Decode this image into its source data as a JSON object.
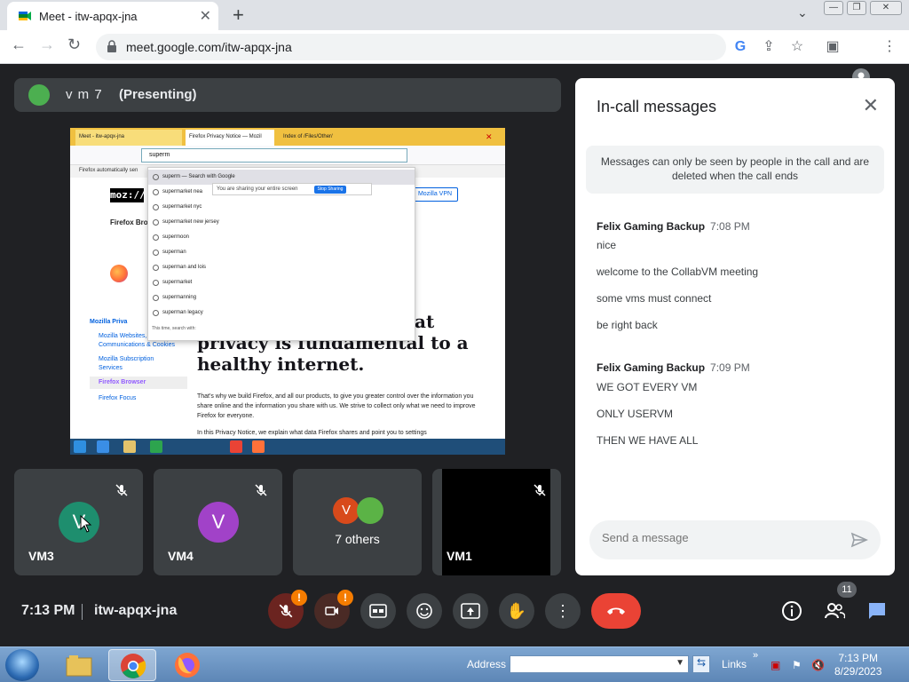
{
  "browser": {
    "tab_title": "Meet - itw-apqx-jna",
    "url": "meet.google.com/itw-apqx-jna"
  },
  "presenter": {
    "name": "v m 7",
    "tag": "(Presenting)"
  },
  "shared_screen": {
    "tabs": [
      "Meet - itw-apqx-jna",
      "Firefox Privacy Notice — Mozil",
      "Index of /Files/Other/"
    ],
    "search_text": "superm",
    "infobar": "Firefox automatically sen",
    "suggestions": [
      "superm — Search with Google",
      "supermarket nea",
      "supermarket nyc",
      "supermarket new jersey",
      "supermoon",
      "superman",
      "superman and lois",
      "supermarket",
      "supermanning",
      "superman legacy"
    ],
    "share_notice": "You are sharing your entire screen",
    "stop_sharing": "Stop Sharing",
    "search_footer": "This time, search with:",
    "logo": "moz://a",
    "vpn": "Mozilla VPN",
    "firefox_bro": "Firefox Bro",
    "nav_title": "Mozilla Priva",
    "nav_items": [
      "Mozilla Websites, Communications & Cookies",
      "Mozilla Subscription Services",
      "Firefox Browser",
      "Firefox Focus"
    ],
    "headline_1": "at",
    "headline_2": "privacy is fundamental to a",
    "headline_3": "healthy internet.",
    "paragraph": "That's why we build Firefox, and all our products, to give you greater control over the information you share online and the information you share with us. We strive to collect only what we need to improve Firefox for everyone.",
    "paragraph2": "In this Privacy Notice, we explain what data Firefox shares and point you to settings"
  },
  "tiles": [
    {
      "label": "VM3",
      "initial": "V",
      "color": "#1e8e6e"
    },
    {
      "label": "VM4",
      "initial": "V",
      "color": "#a142c8"
    },
    {
      "label": "7 others",
      "initial": "V",
      "color": "#d84a1b",
      "color2": "#5bb346"
    },
    {
      "label": "VM1"
    }
  ],
  "chat": {
    "title": "In-call messages",
    "notice": "Messages can only be seen by people in the call and are deleted when the call ends",
    "groups": [
      {
        "sender": "Felix Gaming Backup",
        "time": "7:08 PM",
        "messages": [
          "nice",
          "welcome to the CollabVM meeting",
          "some vms must connect",
          "be right back"
        ]
      },
      {
        "sender": "Felix Gaming Backup",
        "time": "7:09 PM",
        "messages": [
          "WE GOT EVERY VM",
          "ONLY USERVM",
          "THEN WE HAVE ALL"
        ]
      }
    ],
    "input_placeholder": "Send a message"
  },
  "controls": {
    "clock": "7:13 PM",
    "meeting_code": "itw-apqx-jna",
    "participants_count": "11",
    "mic_badge": "!",
    "cam_badge": "!"
  },
  "taskbar": {
    "address_label": "Address",
    "links_label": "Links",
    "time": "7:13 PM",
    "date": "8/29/2023"
  },
  "colors": {
    "meet_bg": "#202124",
    "end_call": "#ea4335",
    "accent": "#1a73e8"
  }
}
